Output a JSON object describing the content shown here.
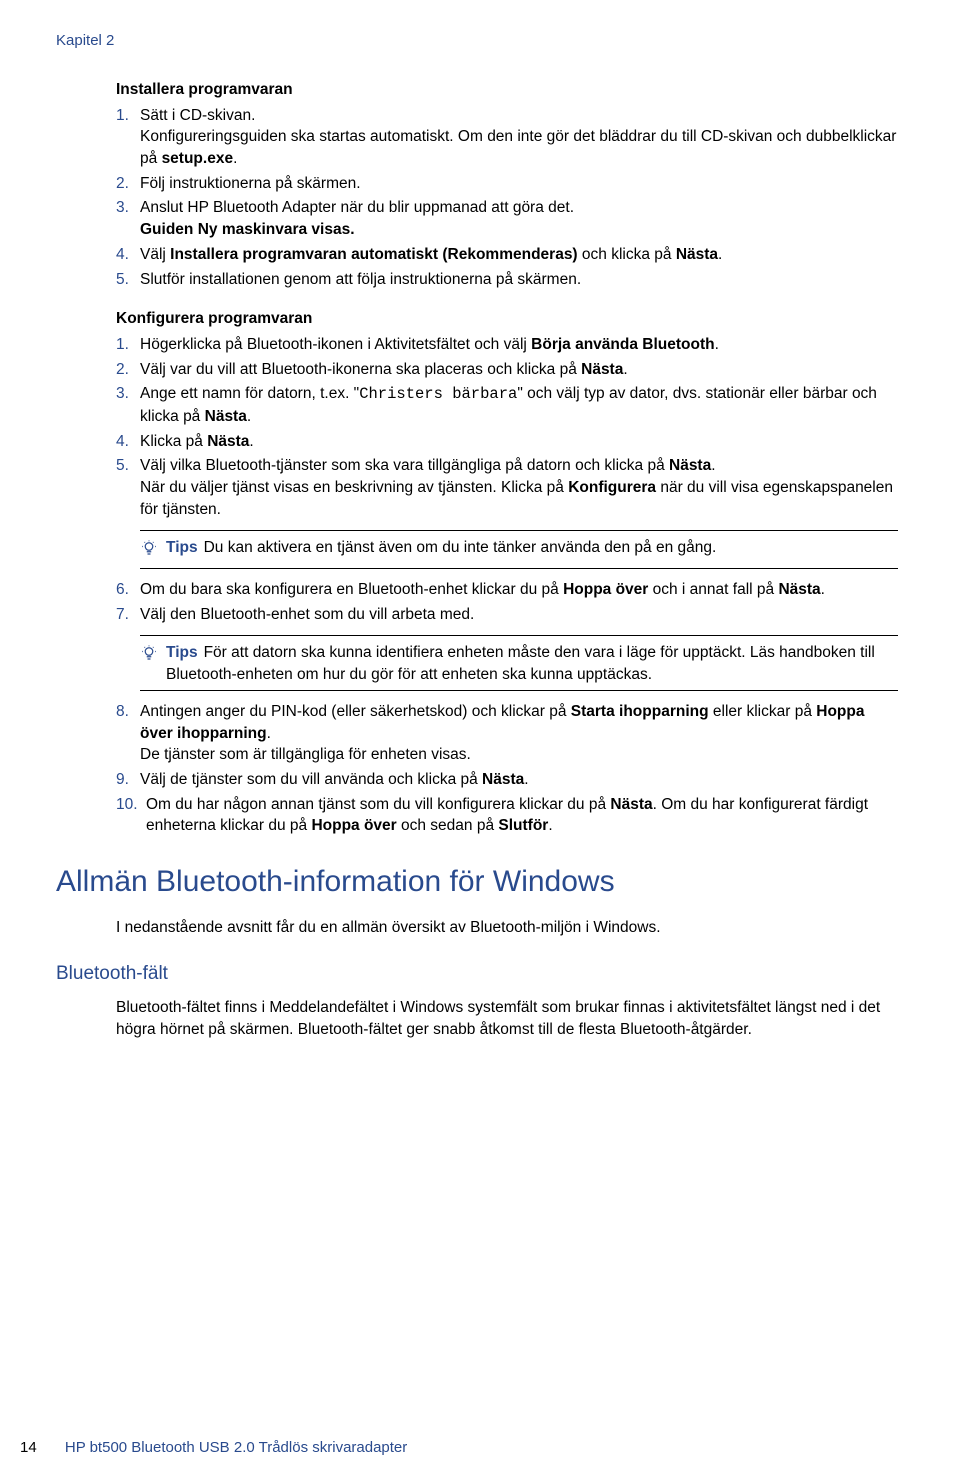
{
  "chapter": "Kapitel 2",
  "install": {
    "heading": "Installera programvaran",
    "steps": [
      {
        "n": "1.",
        "pre": "Sätt i CD-skivan.",
        "after": "Konfigureringsguiden ska startas automatiskt. Om den inte gör det bläddrar du till CD-skivan och dubbelklickar på ",
        "bold": "setup.exe",
        "tail": "."
      },
      {
        "n": "2.",
        "text": "Följ instruktionerna på skärmen."
      },
      {
        "n": "3.",
        "text": "Anslut HP Bluetooth Adapter när du blir uppmanad att göra det.",
        "after_bold": "Guiden Ny maskinvara visas."
      },
      {
        "n": "4.",
        "pre": "Välj ",
        "bold": "Installera programvaran automatiskt (Rekommenderas)",
        "mid": " och klicka på ",
        "bold2": "Nästa",
        "tail": "."
      },
      {
        "n": "5.",
        "text": "Slutför installationen genom att följa instruktionerna på skärmen."
      }
    ]
  },
  "configure": {
    "heading": "Konfigurera programvaran",
    "s1": {
      "n": "1.",
      "pre": "Högerklicka på Bluetooth-ikonen i Aktivitetsfältet och välj ",
      "bold": "Börja använda Bluetooth",
      "tail": "."
    },
    "s2": {
      "n": "2.",
      "pre": "Välj var du vill att Bluetooth-ikonerna ska placeras och klicka på ",
      "bold": "Nästa",
      "tail": "."
    },
    "s3": {
      "n": "3.",
      "pre": "Ange ett namn för datorn, t.ex. \"",
      "mono": "Christers bärbara",
      "mid": "\" och välj typ av dator, dvs. stationär eller bärbar och klicka på ",
      "bold": "Nästa",
      "tail": "."
    },
    "s4": {
      "n": "4.",
      "pre": "Klicka på ",
      "bold": "Nästa",
      "tail": "."
    },
    "s5": {
      "n": "5.",
      "pre": "Välj vilka Bluetooth-tjänster som ska vara tillgängliga på datorn och klicka på ",
      "bold": "Nästa",
      "tail": ".",
      "p2a": "När du väljer tjänst visas en beskrivning av tjänsten. Klicka på ",
      "p2b": "Konfigurera",
      "p2c": " när du vill visa egenskapspanelen för tjänsten."
    },
    "tip1": {
      "label": "Tips",
      "text": "Du kan aktivera en tjänst även om du inte tänker använda den på en gång."
    },
    "s6": {
      "n": "6.",
      "pre": "Om du bara ska konfigurera en Bluetooth-enhet klickar du på ",
      "bold": "Hoppa över",
      "mid": " och i annat fall på ",
      "bold2": "Nästa",
      "tail": "."
    },
    "s7": {
      "n": "7.",
      "text": "Välj den Bluetooth-enhet som du vill arbeta med."
    },
    "tip2": {
      "label": "Tips",
      "text": "För att datorn ska kunna identifiera enheten måste den vara i läge för upptäckt. Läs handboken till Bluetooth-enheten om hur du gör för att enheten ska kunna upptäckas."
    },
    "s8": {
      "n": "8.",
      "pre": "Antingen anger du PIN-kod (eller säkerhetskod) och klickar på ",
      "bold": "Starta ihopparning",
      "mid": " eller klickar på ",
      "bold2": "Hoppa över ihopparning",
      "tail": ".",
      "p2": "De tjänster som är tillgängliga för enheten visas."
    },
    "s9": {
      "n": "9.",
      "pre": "Välj de tjänster som du vill använda och klicka på ",
      "bold": "Nästa",
      "tail": "."
    },
    "s10": {
      "n": "10.",
      "pre": "Om du har någon annan tjänst som du vill konfigurera klickar du på ",
      "bold": "Nästa",
      "mid": ". Om du har konfigurerat färdigt enheterna klickar du på ",
      "bold2": "Hoppa över",
      "mid2": " och sedan på ",
      "bold3": "Slutför",
      "tail": "."
    }
  },
  "main_heading": "Allmän Bluetooth-information för Windows",
  "main_para": "I nedanstående avsnitt får du en allmän översikt av Bluetooth-miljön i Windows.",
  "sub_heading": "Bluetooth-fält",
  "sub_para": "Bluetooth-fältet finns i Meddelandefältet i Windows systemfält som brukar finnas i aktivitetsfältet längst ned i det högra hörnet på skärmen. Bluetooth-fältet ger snabb åtkomst till de flesta Bluetooth-åtgärder.",
  "footer": {
    "page": "14",
    "title": "HP bt500 Bluetooth USB 2.0 Trådlös skrivaradapter"
  }
}
